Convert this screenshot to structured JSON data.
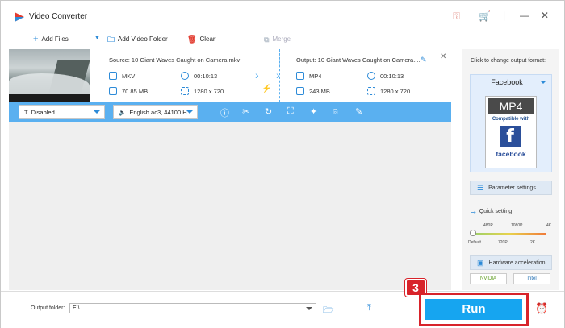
{
  "window": {
    "title": "Video Converter"
  },
  "toolbar": {
    "add_files": "Add Files",
    "add_video_folder": "Add Video Folder",
    "clear": "Clear",
    "merge": "Merge"
  },
  "source": {
    "title": "Source: 10 Giant Waves Caught on Camera.mkv",
    "format": "MKV",
    "duration": "00:10:13",
    "size": "70.85 MB",
    "resolution": "1280 x 720"
  },
  "output": {
    "title": "Output: 10 Giant Waves Caught on Camera....",
    "format": "MP4",
    "duration": "00:10:13",
    "size": "243 MB",
    "resolution": "1280 x 720"
  },
  "editbar": {
    "subtitle": "Disabled",
    "audio": "English ac3, 44100 H"
  },
  "right_panel": {
    "change_label": "Click to change output format:",
    "format_name": "Facebook",
    "card_format": "MP4",
    "card_compat": "Compatible with",
    "card_brand": "facebook",
    "parameter_settings": "Parameter settings",
    "quick_setting": "Quick setting",
    "quality_top": [
      "480P",
      "1080P",
      "4K"
    ],
    "quality_bottom": [
      "Default",
      "720P",
      "2K"
    ],
    "quality_level": 0,
    "hardware_acceleration": "Hardware acceleration",
    "nvidia": "NVIDIA",
    "intel": "Intel"
  },
  "bottom": {
    "output_folder_label": "Output folder:",
    "output_folder_value": "E:\\",
    "run": "Run",
    "step_badge": "3"
  },
  "colors": {
    "accent": "#16a5f0",
    "highlight": "#d8232a",
    "editbar": "#5ab0f0"
  }
}
